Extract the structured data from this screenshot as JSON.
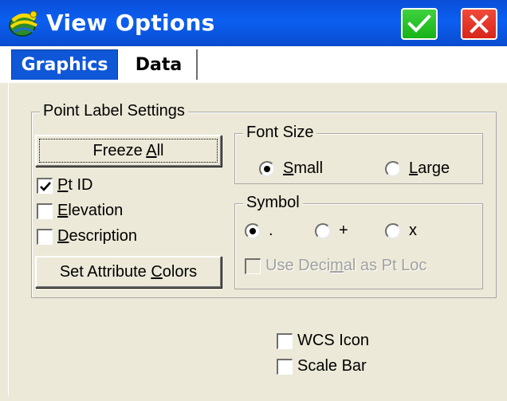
{
  "window": {
    "title": "View Options",
    "ok_icon": "checkmark-icon",
    "close_icon": "close-x-icon",
    "app_icon": "globe-satellite-icon",
    "colors": {
      "titlebar": "#0b5ff0",
      "ok": "#17b317",
      "close": "#d8261a",
      "active_tab": "#1057d8"
    }
  },
  "tabs": [
    {
      "label": "Graphics",
      "active": true
    },
    {
      "label": "Data",
      "active": false
    }
  ],
  "point_label_settings": {
    "legend": "Point Label Settings",
    "freeze_all": {
      "label_pre": "Freeze ",
      "label_u": "A",
      "label_post": "ll"
    },
    "checkboxes": [
      {
        "label_pre": "",
        "label_u": "P",
        "label_post": "t ID",
        "checked": true
      },
      {
        "label_pre": "",
        "label_u": "E",
        "label_post": "levation",
        "checked": false
      },
      {
        "label_pre": "",
        "label_u": "D",
        "label_post": "escription",
        "checked": false
      }
    ],
    "set_attribute_colors": {
      "label_pre": "Set Attribute ",
      "label_u": "C",
      "label_post": "olors"
    },
    "font_size": {
      "legend": "Font Size",
      "options": [
        {
          "label_pre": "",
          "label_u": "S",
          "label_post": "mall",
          "selected": true
        },
        {
          "label_pre": "",
          "label_u": "L",
          "label_post": "arge",
          "selected": false
        }
      ]
    },
    "symbol": {
      "legend": "Symbol",
      "options": [
        {
          "label": ".",
          "selected": true
        },
        {
          "label": "+",
          "selected": false
        },
        {
          "label": "x",
          "selected": false
        }
      ],
      "use_decimal": {
        "label_pre": "Use Deci",
        "label_u": "m",
        "label_post": "al as Pt Loc",
        "checked": false,
        "enabled": false
      }
    }
  },
  "extras": [
    {
      "label": "WCS Icon",
      "checked": false
    },
    {
      "label": "Scale Bar",
      "checked": false
    }
  ]
}
